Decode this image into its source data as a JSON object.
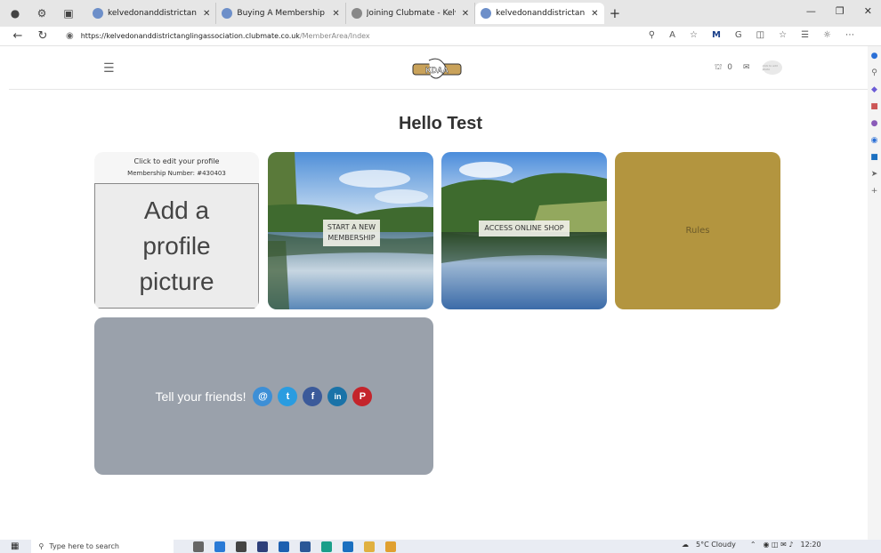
{
  "browser": {
    "tabs": [
      {
        "title": "kelvedonanddistrictanglingasso",
        "active": false
      },
      {
        "title": "Buying A Membership Guide | Cl",
        "active": false
      },
      {
        "title": "Joining Clubmate - Kelvedon Dis",
        "active": false
      },
      {
        "title": "kelvedonanddistrictanglingasso",
        "active": true
      }
    ],
    "url_main": "https://kelvedonanddistrictanglingassociation.clubmate.co.uk",
    "url_path": "/MemberArea/Index"
  },
  "header": {
    "logo_text": "KDAA",
    "basket_count": "0",
    "avatar_text": "click to add photo"
  },
  "main": {
    "greeting": "Hello Test",
    "profile": {
      "edit_label": "Click to edit your profile",
      "membership_label": "Membership Number: #430403",
      "picture_line1": "Add a",
      "picture_line2": "profile",
      "picture_line3": "picture"
    },
    "tiles": {
      "new_membership_line1": "START A NEW",
      "new_membership_line2": "MEMBERSHIP",
      "shop": "ACCESS ONLINE SHOP",
      "rules": "Rules"
    },
    "share": {
      "text": "Tell your friends!",
      "email_glyph": "@",
      "twitter_glyph": "t",
      "facebook_glyph": "f",
      "linkedin_glyph": "in",
      "pinterest_glyph": "P"
    }
  },
  "taskbar": {
    "search_placeholder": "Type here to search",
    "weather": "5°C Cloudy",
    "time": "12:20"
  },
  "colors": {
    "rules_bg": "#b3953f",
    "share_bg": "#9aa1ab",
    "email": "#3d8fd6",
    "twitter": "#2a9ce0",
    "facebook": "#3b5a9a",
    "linkedin": "#1a73a8",
    "pinterest": "#c4242b"
  }
}
